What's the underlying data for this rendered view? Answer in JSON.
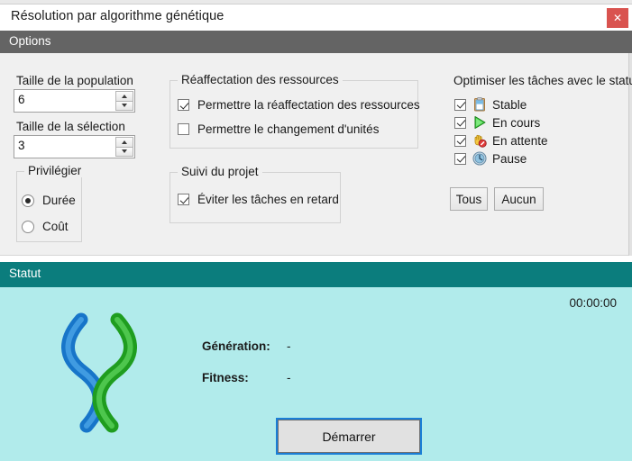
{
  "window": {
    "title": "Résolution par algorithme génétique",
    "close_label": "✕",
    "close_icon": "close-icon"
  },
  "menubar": {
    "items": [
      {
        "label": "Options"
      }
    ]
  },
  "population": {
    "size_label": "Taille de la population",
    "size_value": "6",
    "selection_label": "Taille de la sélection",
    "selection_value": "3"
  },
  "privilegier": {
    "title": "Privilégier",
    "options": [
      {
        "label": "Durée",
        "checked": true
      },
      {
        "label": "Coût",
        "checked": false
      }
    ]
  },
  "reaffectation": {
    "title": "Réaffectation des ressources",
    "options": [
      {
        "label": "Permettre la réaffectation des ressources",
        "checked": true
      },
      {
        "label": "Permettre le changement d'unités",
        "checked": false
      }
    ]
  },
  "suivi": {
    "title": "Suivi du projet",
    "options": [
      {
        "label": "Éviter les tâches en retard",
        "checked": true
      }
    ]
  },
  "statuts": {
    "title": "Optimiser les tâches avec le statut..",
    "options": [
      {
        "label": "Stable",
        "checked": true,
        "icon": "clipboard-icon"
      },
      {
        "label": "En cours",
        "checked": true,
        "icon": "play-icon"
      },
      {
        "label": "En attente",
        "checked": true,
        "icon": "hand-stop-icon"
      },
      {
        "label": "Pause",
        "checked": true,
        "icon": "clock-icon"
      }
    ],
    "select_all_label": "Tous",
    "select_none_label": "Aucun"
  },
  "statut_section": {
    "header": "Statut",
    "timer": "00:00:00",
    "generation_label": "Génération:",
    "generation_value": "-",
    "fitness_label": "Fitness:",
    "fitness_value": "-",
    "start_label": "Démarrer",
    "logo_icon": "dna-helix-icon"
  },
  "colors": {
    "menubar": "#646464",
    "statut_header": "#0b7d7d",
    "statut_body": "#b1ebeb",
    "close_button": "#d9534f",
    "focus_outline": "#1a7ed6",
    "helix_blue": "#1e88e0",
    "helix_green": "#1f9d1f"
  }
}
